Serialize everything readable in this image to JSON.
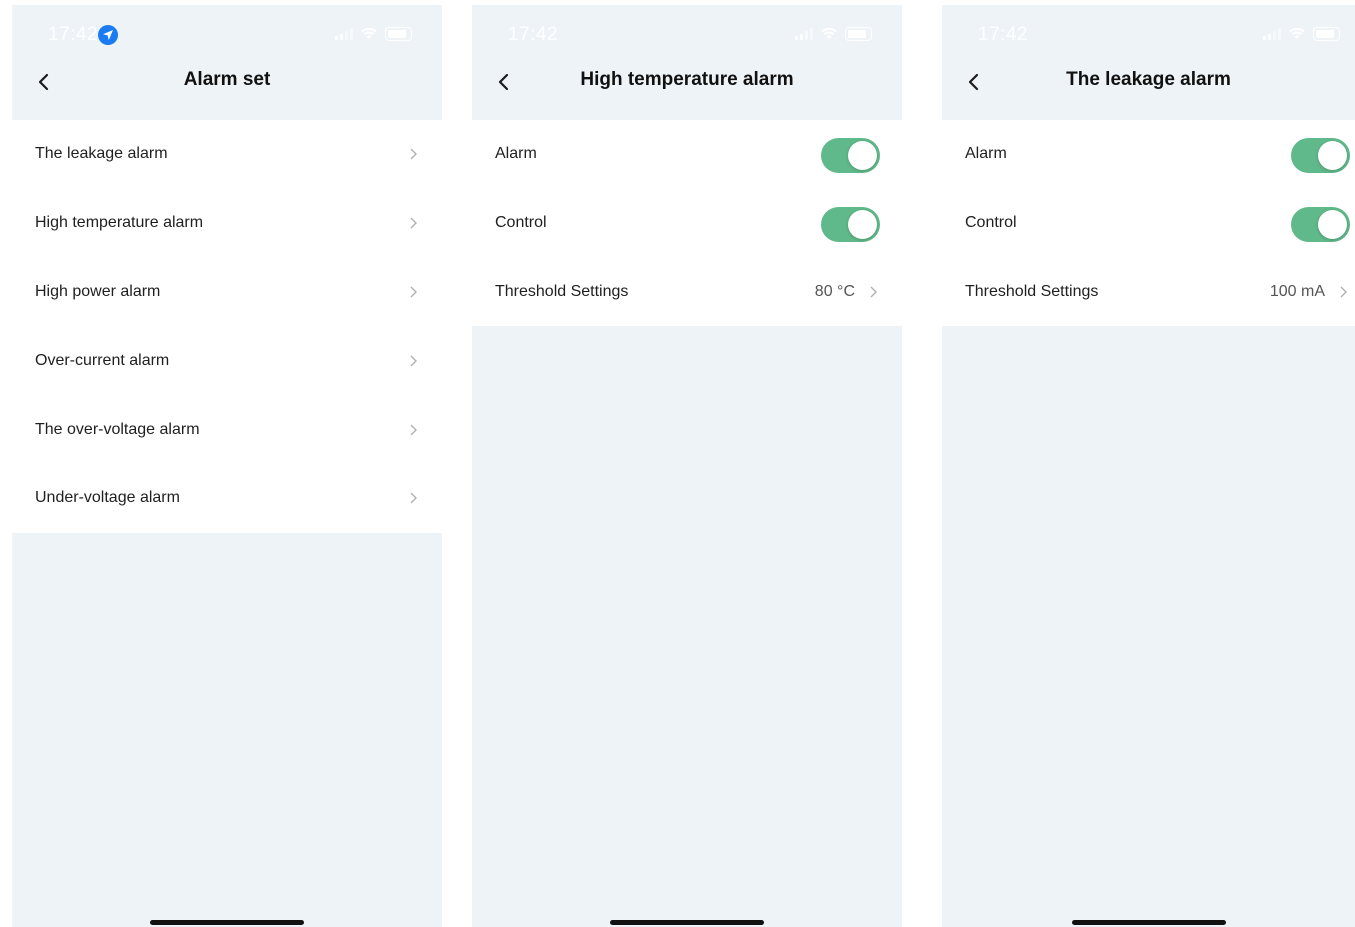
{
  "status_bar": {
    "time": "17:42"
  },
  "screens": [
    {
      "title": "Alarm set",
      "items": [
        {
          "label": "The leakage alarm"
        },
        {
          "label": "High temperature alarm"
        },
        {
          "label": "High power alarm"
        },
        {
          "label": "Over-current alarm"
        },
        {
          "label": "The over-voltage alarm"
        },
        {
          "label": "Under-voltage alarm"
        }
      ]
    },
    {
      "title": "High temperature alarm",
      "alarm": {
        "label": "Alarm",
        "on": true
      },
      "control": {
        "label": "Control",
        "on": true
      },
      "threshold": {
        "label": "Threshold Settings",
        "value": "80 °C"
      }
    },
    {
      "title": "The leakage alarm",
      "alarm": {
        "label": "Alarm",
        "on": true
      },
      "control": {
        "label": "Control",
        "on": true
      },
      "threshold": {
        "label": "Threshold Settings",
        "value": "100 mA"
      }
    }
  ],
  "colors": {
    "background": "#eef3f8",
    "toggle_on": "#5fb98a",
    "location_icon": "#1a7cf0"
  },
  "icons": [
    "location-icon",
    "signal-icon",
    "wifi-icon",
    "battery-icon",
    "back-arrow-icon",
    "chevron-right-icon"
  ]
}
